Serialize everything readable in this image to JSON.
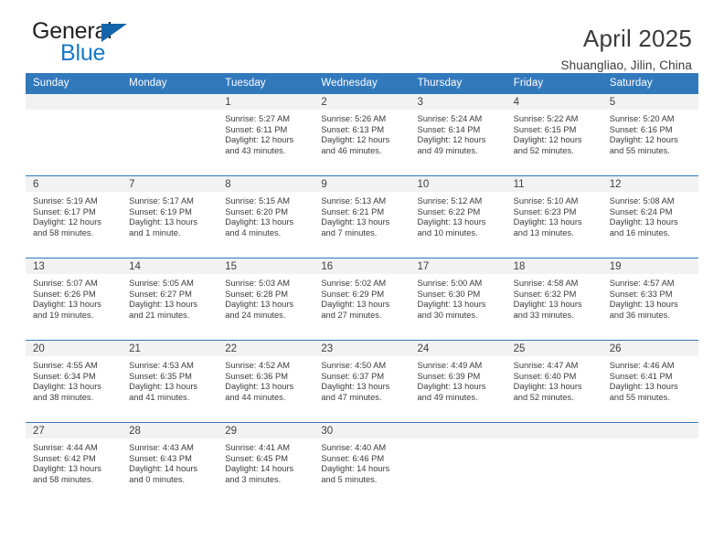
{
  "brand": {
    "name_top": "General",
    "name_bottom": "Blue",
    "triangle_color": "#1464AA",
    "blue_color": "#1878C8"
  },
  "header": {
    "title": "April 2025",
    "subtitle": "Shuangliao, Jilin, China"
  },
  "theme": {
    "header_row_bg": "#3279BC",
    "day_number_band_bg": "#F2F2F2",
    "week_divider": "#3279BC",
    "text": "#3B3B3B"
  },
  "weekday_headers": [
    "Sunday",
    "Monday",
    "Tuesday",
    "Wednesday",
    "Thursday",
    "Friday",
    "Saturday"
  ],
  "weeks": [
    [
      {
        "day": "",
        "info": ""
      },
      {
        "day": "",
        "info": ""
      },
      {
        "day": "1",
        "info": "Sunrise: 5:27 AM\nSunset: 6:11 PM\nDaylight: 12 hours\nand 43 minutes."
      },
      {
        "day": "2",
        "info": "Sunrise: 5:26 AM\nSunset: 6:13 PM\nDaylight: 12 hours\nand 46 minutes."
      },
      {
        "day": "3",
        "info": "Sunrise: 5:24 AM\nSunset: 6:14 PM\nDaylight: 12 hours\nand 49 minutes."
      },
      {
        "day": "4",
        "info": "Sunrise: 5:22 AM\nSunset: 6:15 PM\nDaylight: 12 hours\nand 52 minutes."
      },
      {
        "day": "5",
        "info": "Sunrise: 5:20 AM\nSunset: 6:16 PM\nDaylight: 12 hours\nand 55 minutes."
      }
    ],
    [
      {
        "day": "6",
        "info": "Sunrise: 5:19 AM\nSunset: 6:17 PM\nDaylight: 12 hours\nand 58 minutes."
      },
      {
        "day": "7",
        "info": "Sunrise: 5:17 AM\nSunset: 6:19 PM\nDaylight: 13 hours\nand 1 minute."
      },
      {
        "day": "8",
        "info": "Sunrise: 5:15 AM\nSunset: 6:20 PM\nDaylight: 13 hours\nand 4 minutes."
      },
      {
        "day": "9",
        "info": "Sunrise: 5:13 AM\nSunset: 6:21 PM\nDaylight: 13 hours\nand 7 minutes."
      },
      {
        "day": "10",
        "info": "Sunrise: 5:12 AM\nSunset: 6:22 PM\nDaylight: 13 hours\nand 10 minutes."
      },
      {
        "day": "11",
        "info": "Sunrise: 5:10 AM\nSunset: 6:23 PM\nDaylight: 13 hours\nand 13 minutes."
      },
      {
        "day": "12",
        "info": "Sunrise: 5:08 AM\nSunset: 6:24 PM\nDaylight: 13 hours\nand 16 minutes."
      }
    ],
    [
      {
        "day": "13",
        "info": "Sunrise: 5:07 AM\nSunset: 6:26 PM\nDaylight: 13 hours\nand 19 minutes."
      },
      {
        "day": "14",
        "info": "Sunrise: 5:05 AM\nSunset: 6:27 PM\nDaylight: 13 hours\nand 21 minutes."
      },
      {
        "day": "15",
        "info": "Sunrise: 5:03 AM\nSunset: 6:28 PM\nDaylight: 13 hours\nand 24 minutes."
      },
      {
        "day": "16",
        "info": "Sunrise: 5:02 AM\nSunset: 6:29 PM\nDaylight: 13 hours\nand 27 minutes."
      },
      {
        "day": "17",
        "info": "Sunrise: 5:00 AM\nSunset: 6:30 PM\nDaylight: 13 hours\nand 30 minutes."
      },
      {
        "day": "18",
        "info": "Sunrise: 4:58 AM\nSunset: 6:32 PM\nDaylight: 13 hours\nand 33 minutes."
      },
      {
        "day": "19",
        "info": "Sunrise: 4:57 AM\nSunset: 6:33 PM\nDaylight: 13 hours\nand 36 minutes."
      }
    ],
    [
      {
        "day": "20",
        "info": "Sunrise: 4:55 AM\nSunset: 6:34 PM\nDaylight: 13 hours\nand 38 minutes."
      },
      {
        "day": "21",
        "info": "Sunrise: 4:53 AM\nSunset: 6:35 PM\nDaylight: 13 hours\nand 41 minutes."
      },
      {
        "day": "22",
        "info": "Sunrise: 4:52 AM\nSunset: 6:36 PM\nDaylight: 13 hours\nand 44 minutes."
      },
      {
        "day": "23",
        "info": "Sunrise: 4:50 AM\nSunset: 6:37 PM\nDaylight: 13 hours\nand 47 minutes."
      },
      {
        "day": "24",
        "info": "Sunrise: 4:49 AM\nSunset: 6:39 PM\nDaylight: 13 hours\nand 49 minutes."
      },
      {
        "day": "25",
        "info": "Sunrise: 4:47 AM\nSunset: 6:40 PM\nDaylight: 13 hours\nand 52 minutes."
      },
      {
        "day": "26",
        "info": "Sunrise: 4:46 AM\nSunset: 6:41 PM\nDaylight: 13 hours\nand 55 minutes."
      }
    ],
    [
      {
        "day": "27",
        "info": "Sunrise: 4:44 AM\nSunset: 6:42 PM\nDaylight: 13 hours\nand 58 minutes."
      },
      {
        "day": "28",
        "info": "Sunrise: 4:43 AM\nSunset: 6:43 PM\nDaylight: 14 hours\nand 0 minutes."
      },
      {
        "day": "29",
        "info": "Sunrise: 4:41 AM\nSunset: 6:45 PM\nDaylight: 14 hours\nand 3 minutes."
      },
      {
        "day": "30",
        "info": "Sunrise: 4:40 AM\nSunset: 6:46 PM\nDaylight: 14 hours\nand 5 minutes."
      },
      {
        "day": "",
        "info": ""
      },
      {
        "day": "",
        "info": ""
      },
      {
        "day": "",
        "info": ""
      }
    ]
  ]
}
